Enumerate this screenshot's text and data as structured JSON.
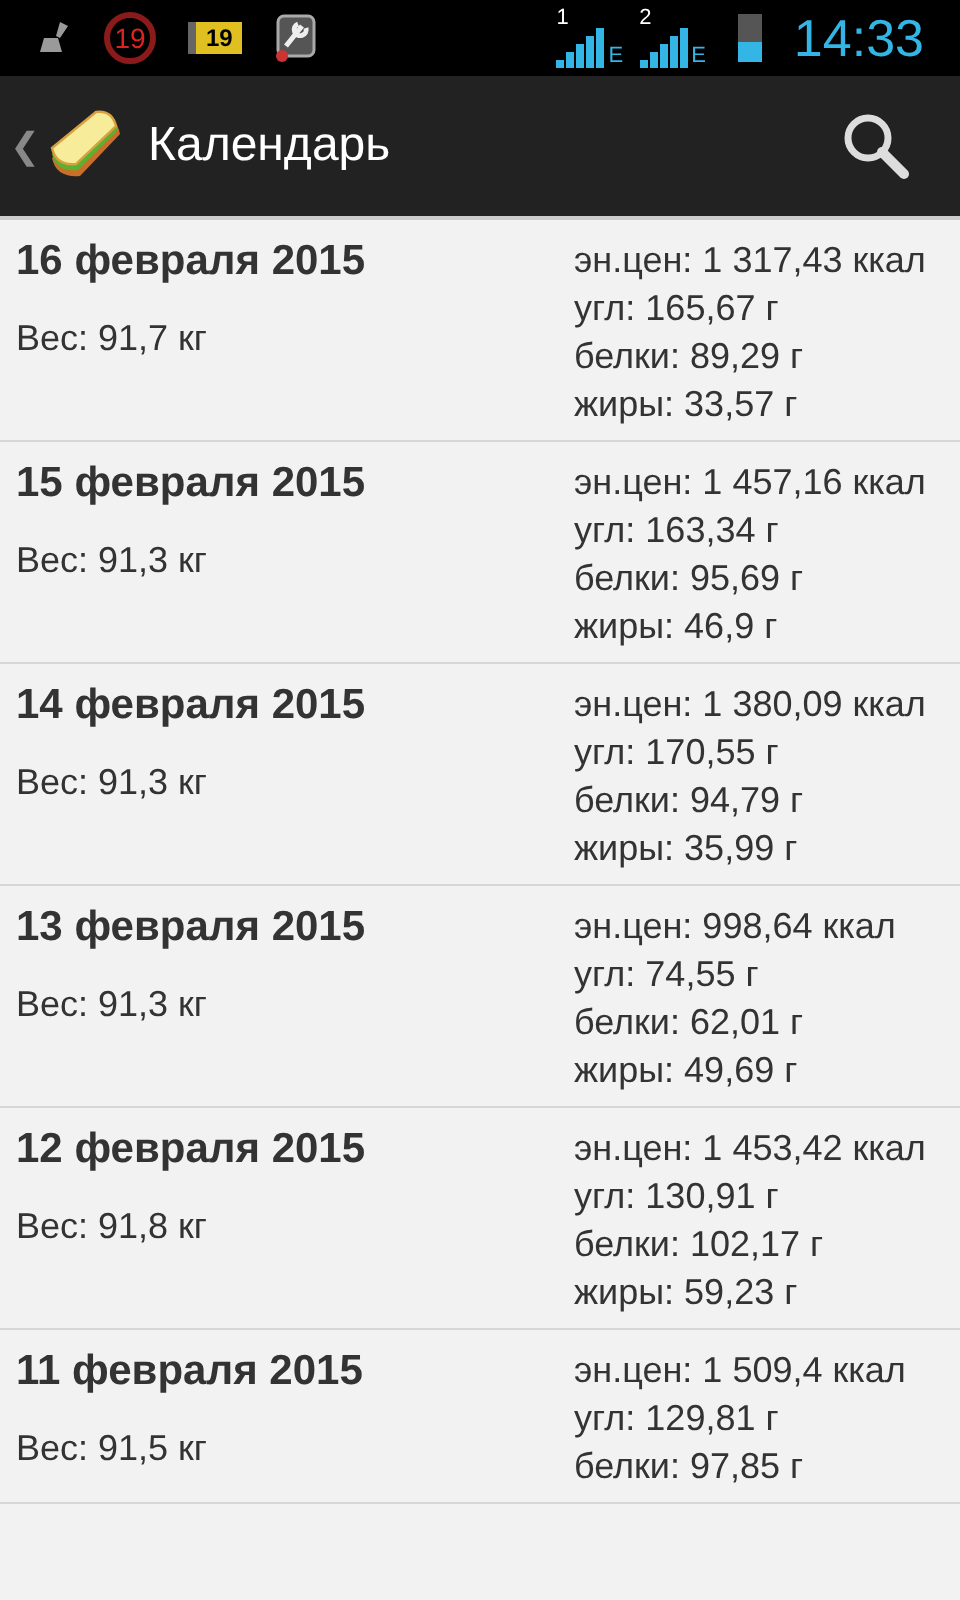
{
  "status_bar": {
    "notifications": [
      {
        "kind": "broom"
      },
      {
        "kind": "circle",
        "text": "19"
      },
      {
        "kind": "badge",
        "text": "19"
      },
      {
        "kind": "tool"
      }
    ],
    "sims": [
      {
        "slot": "1",
        "network": "E"
      },
      {
        "slot": "2",
        "network": "E"
      }
    ],
    "battery": {
      "level": 0.4
    },
    "time": "14:33"
  },
  "action_bar": {
    "back": "❮",
    "title": "Календарь"
  },
  "days": [
    {
      "date": "16 февраля 2015",
      "weight": "Вес: 91,7 кг",
      "energy": "эн.цен: 1 317,43 ккал",
      "carbs": "угл: 165,67 г",
      "protein": "белки: 89,29 г",
      "fat": "жиры: 33,57 г"
    },
    {
      "date": "15 февраля 2015",
      "weight": "Вес: 91,3 кг",
      "energy": "эн.цен: 1 457,16 ккал",
      "carbs": "угл: 163,34 г",
      "protein": "белки: 95,69 г",
      "fat": "жиры: 46,9 г"
    },
    {
      "date": "14 февраля 2015",
      "weight": "Вес: 91,3 кг",
      "energy": "эн.цен: 1 380,09 ккал",
      "carbs": "угл: 170,55 г",
      "protein": "белки: 94,79 г",
      "fat": "жиры: 35,99 г"
    },
    {
      "date": "13 февраля 2015",
      "weight": "Вес: 91,3 кг",
      "energy": "эн.цен: 998,64 ккал",
      "carbs": "угл: 74,55 г",
      "protein": "белки: 62,01 г",
      "fat": "жиры: 49,69 г"
    },
    {
      "date": "12 февраля 2015",
      "weight": "Вес: 91,8 кг",
      "energy": "эн.цен: 1 453,42 ккал",
      "carbs": "угл: 130,91 г",
      "protein": "белки: 102,17 г",
      "fat": "жиры: 59,23 г"
    },
    {
      "date": "11 февраля 2015",
      "weight": "Вес: 91,5 кг",
      "energy": "эн.цен: 1 509,4 ккал",
      "carbs": "угл: 129,81 г",
      "protein": "белки: 97,85 г"
    }
  ]
}
